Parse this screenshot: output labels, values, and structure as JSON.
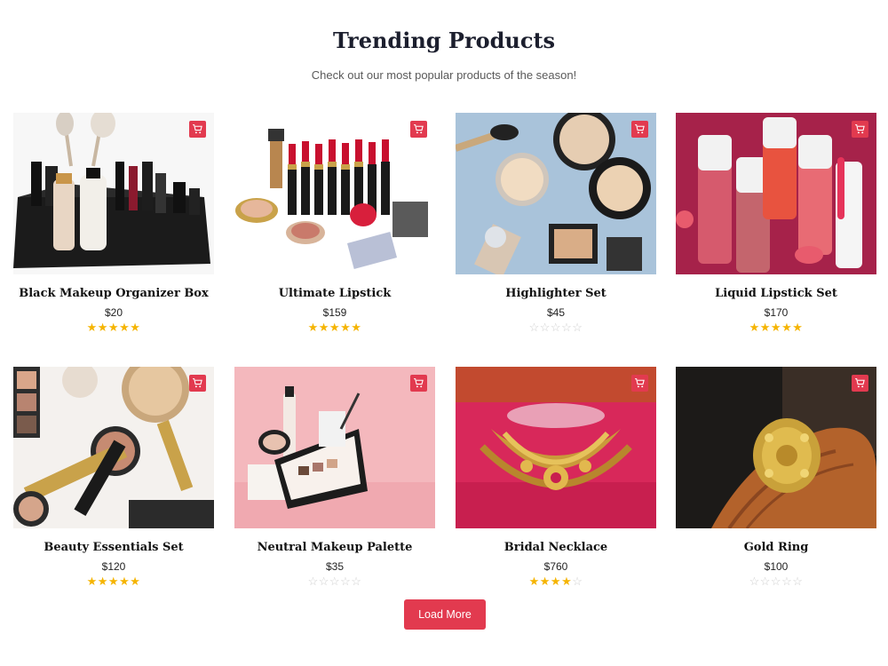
{
  "section": {
    "title": "Trending Products",
    "subtitle": "Check out our most popular products of the season!"
  },
  "accent_color": "#e23a4f",
  "star_color": "#f5b400",
  "products": [
    {
      "name": "Black Makeup Organizer Box",
      "price": "$20",
      "rating": 5,
      "image": "makeup-organizer"
    },
    {
      "name": "Ultimate Lipstick",
      "price": "$159",
      "rating": 5,
      "image": "lipstick-collection"
    },
    {
      "name": "Highlighter Set",
      "price": "$45",
      "rating": 0,
      "image": "highlighter-powders"
    },
    {
      "name": "Liquid Lipstick Set",
      "price": "$170",
      "rating": 5,
      "image": "liquid-lipsticks"
    },
    {
      "name": "Beauty Essentials Set",
      "price": "$120",
      "rating": 5,
      "image": "beauty-essentials"
    },
    {
      "name": "Neutral Makeup Palette",
      "price": "$35",
      "rating": 0,
      "image": "makeup-palette"
    },
    {
      "name": "Bridal Necklace",
      "price": "$760",
      "rating": 4,
      "image": "bridal-necklace"
    },
    {
      "name": "Gold Ring",
      "price": "$100",
      "rating": 0,
      "image": "gold-ring"
    }
  ],
  "cart_icon": "shopping-cart-icon",
  "load_more_label": "Load More"
}
